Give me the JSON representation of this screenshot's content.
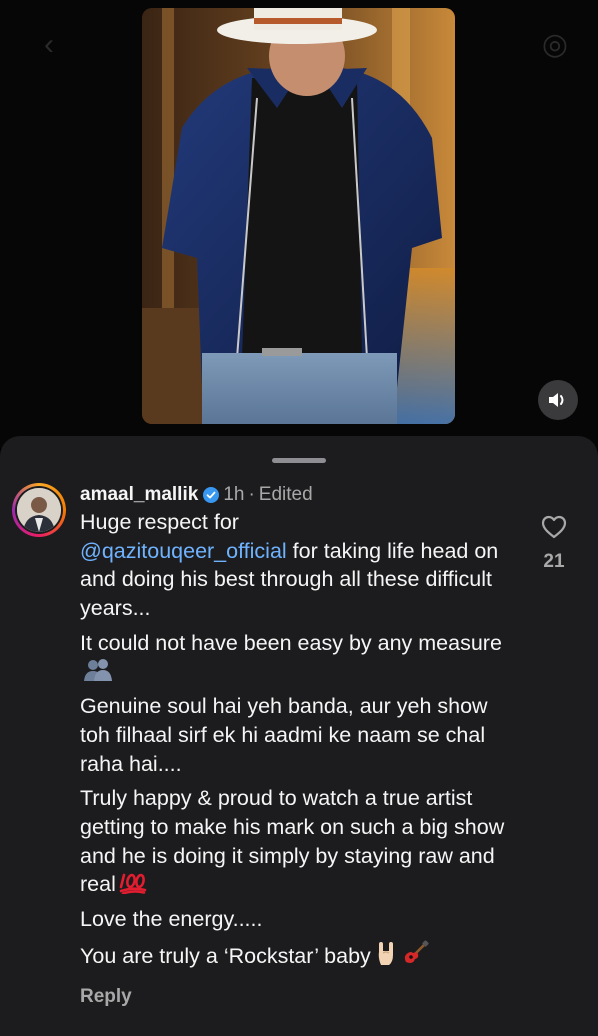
{
  "header": {
    "back_icon": "chevron-left-icon",
    "camera_icon": "camera-icon"
  },
  "video": {
    "mute_icon": "speaker-icon"
  },
  "comment": {
    "username": "amaal_mallik",
    "verified_icon": "verified-badge-icon",
    "time": "1h",
    "separator": "·",
    "edited": "Edited",
    "mention": "@qazitouqeer_official",
    "p1_before": "Huge respect for",
    "p1_after": " for taking life head on and doing his best through all these difficult years...",
    "p2": "It could not have been easy by any measure",
    "p3": "Genuine soul hai yeh banda, aur yeh show toh filhaal sirf ek hi aadmi ke naam se chal raha hai....",
    "p4": "Truly happy & proud to watch a true artist getting to make his mark on such a big show and he is doing it simply by staying raw and real",
    "p5": "Love the energy.....",
    "p6": "You are truly a ‘Rockstar’ baby",
    "like_count": "21",
    "reply_label": "Reply"
  },
  "colors": {
    "sheet_bg": "#1c1c1e",
    "mention": "#6fb3ff",
    "secondary_text": "#a8a8a8",
    "verified": "#3897f0",
    "hundred": "#e11d2f"
  }
}
